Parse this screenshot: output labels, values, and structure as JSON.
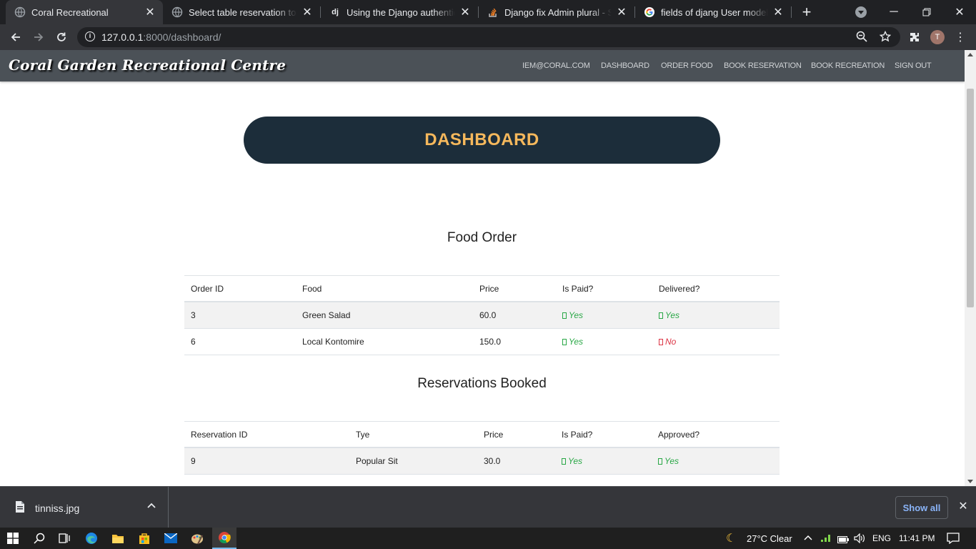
{
  "browser": {
    "tabs": [
      {
        "title": "Coral Recreational",
        "active": true
      },
      {
        "title": "Select table reservation to ch",
        "active": false
      },
      {
        "title": "Using the Django authenticat",
        "active": false,
        "favicon_text": "dj"
      },
      {
        "title": "Django fix Admin plural - Sta",
        "active": false
      },
      {
        "title": "fields of djang User model - (",
        "active": false
      }
    ],
    "new_tab": "+",
    "url_host": "127.0.0.1",
    "url_rest": ":8000/dashboard/",
    "profile_initial": "T"
  },
  "site": {
    "brand": "Coral Garden Recreational Centre",
    "nav": [
      "IEM@CORAL.COM",
      "DASHBOARD",
      "ORDER FOOD",
      "BOOK RESERVATION",
      "BOOK RECREATION",
      "SIGN OUT"
    ],
    "banner": "DASHBOARD"
  },
  "food_order": {
    "title": "Food Order",
    "headers": [
      "Order ID",
      "Food",
      "Price",
      "Is Paid?",
      "Delivered?"
    ],
    "rows": [
      {
        "id": "3",
        "food": "Green Salad",
        "price": "60.0",
        "paid": "Yes",
        "delivered": "Yes"
      },
      {
        "id": "6",
        "food": "Local Kontomire",
        "price": "150.0",
        "paid": "Yes",
        "delivered": "No"
      }
    ]
  },
  "reservations": {
    "title": "Reservations Booked",
    "headers": [
      "Reservation ID",
      "Tye",
      "Price",
      "Is Paid?",
      "Approved?"
    ],
    "rows": [
      {
        "id": "9",
        "type": "Popular Sit",
        "price": "30.0",
        "paid": "Yes",
        "approved": "Yes"
      }
    ]
  },
  "downloads": {
    "file": "tinniss.jpg",
    "show_all": "Show all"
  },
  "taskbar": {
    "weather": "27°C  Clear",
    "lang": "ENG",
    "time": "11:41 PM"
  },
  "colors": {
    "navbar": "#4b5157",
    "banner_bg": "#1c2d3a",
    "banner_text": "#f5b85c",
    "yes": "#28a745",
    "no": "#dc3545"
  }
}
